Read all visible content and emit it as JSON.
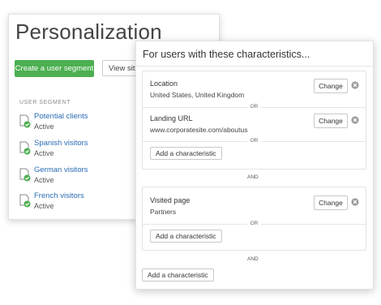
{
  "back_panel": {
    "title": "Personalization",
    "create_button": "Create a user segment",
    "view_button": "View site",
    "segment_header": "USER SEGMENT",
    "segments": [
      {
        "name": "Potential clients",
        "status": "Active"
      },
      {
        "name": "Spanish visitors",
        "status": "Active"
      },
      {
        "name": "German visitors",
        "status": "Active"
      },
      {
        "name": "French visitors",
        "status": "Active"
      }
    ]
  },
  "front_panel": {
    "title": "For users with these characteristics...",
    "groups": [
      {
        "characteristics": [
          {
            "label": "Location",
            "value": "United States, United Kingdom",
            "change": "Change"
          },
          {
            "label": "Landing URL",
            "value": "www.corporatesite.com/aboutus",
            "change": "Change"
          }
        ],
        "or_labels": [
          "OR",
          "OR"
        ],
        "add_label": "Add a characteristic"
      },
      {
        "characteristics": [
          {
            "label": "Visited page",
            "value": "Partners",
            "change": "Change"
          }
        ],
        "or_labels": [
          "OR"
        ],
        "add_label": "Add a characteristic"
      }
    ],
    "and_labels": [
      "AND",
      "AND"
    ],
    "add_label": "Add a characteristic"
  },
  "colors": {
    "accent_green": "#4caf50",
    "link_blue": "#2a6db5"
  }
}
